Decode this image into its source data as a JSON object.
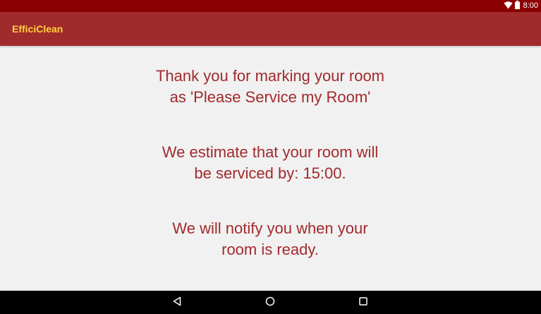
{
  "status_bar": {
    "time": "8:00",
    "icons": [
      "wifi-icon",
      "battery-icon"
    ],
    "color": "#8b0000"
  },
  "app_bar": {
    "title": "EfficiClean",
    "color": "#a12a2d",
    "title_color": "#ffd23a"
  },
  "main": {
    "messages": [
      "Thank you for marking your room\nas 'Please Service my Room'",
      "We estimate that your room will\nbe serviced by: 15:00.",
      "We will notify you when your\nroom is ready."
    ],
    "text_color": "#a12a2d"
  },
  "nav_bar": {
    "buttons": [
      "back-icon",
      "home-icon",
      "recents-icon"
    ]
  }
}
